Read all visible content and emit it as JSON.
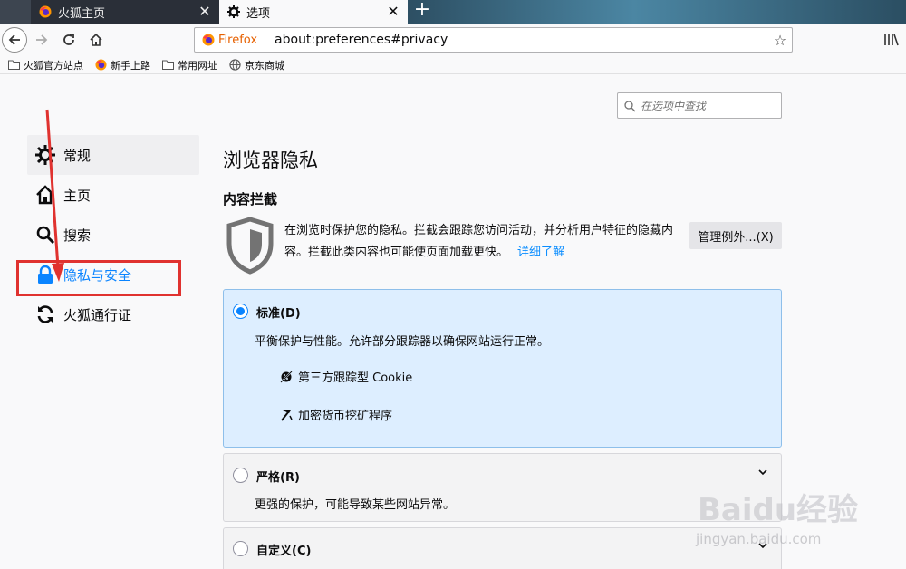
{
  "tabs": [
    {
      "title": "火狐主页",
      "icon": "firefox-icon",
      "close": "✕"
    },
    {
      "title": "选项",
      "icon": "gear-icon",
      "close": "✕"
    }
  ],
  "new_tab": "+",
  "urlbar": {
    "identity": "Firefox",
    "url": "about:preferences#privacy"
  },
  "bookmarks": [
    {
      "label": "火狐官方站点",
      "icon": "folder-icon"
    },
    {
      "label": "新手上路",
      "icon": "firefox-icon"
    },
    {
      "label": "常用网址",
      "icon": "folder-icon"
    },
    {
      "label": "京东商城",
      "icon": "globe-icon"
    }
  ],
  "search": {
    "placeholder": "在选项中查找"
  },
  "sidebar": {
    "items": [
      {
        "label": "常规",
        "icon": "gear-icon"
      },
      {
        "label": "主页",
        "icon": "home-icon"
      },
      {
        "label": "搜索",
        "icon": "search-icon"
      },
      {
        "label": "隐私与安全",
        "icon": "lock-icon"
      },
      {
        "label": "火狐通行证",
        "icon": "sync-icon"
      }
    ]
  },
  "main": {
    "title": "浏览器隐私",
    "section": "内容拦截",
    "description": "在浏览时保护您的隐私。拦截会跟踪您访问活动，并分析用户特征的隐藏内容。拦截此类内容也可能使页面加载更快。",
    "learn_more": "详细了解",
    "manage_button": "管理例外...(X)"
  },
  "options": {
    "standard": {
      "label": "标准(D)",
      "desc": "平衡保护与性能。允许部分跟踪器以确保网站运行正常。",
      "features": [
        "第三方跟踪型 Cookie",
        "加密货币挖矿程序"
      ]
    },
    "strict": {
      "label": "严格(R)",
      "desc": "更强的保护，可能导致某些网站异常。"
    },
    "custom": {
      "label": "自定义(C)"
    }
  },
  "watermark": {
    "brand": "Baidu经验",
    "url": "jingyan.baidu.com"
  },
  "colors": {
    "accent": "#0a84ff",
    "highlight_red": "#e0322f",
    "selected_card": "#ddeeff"
  }
}
